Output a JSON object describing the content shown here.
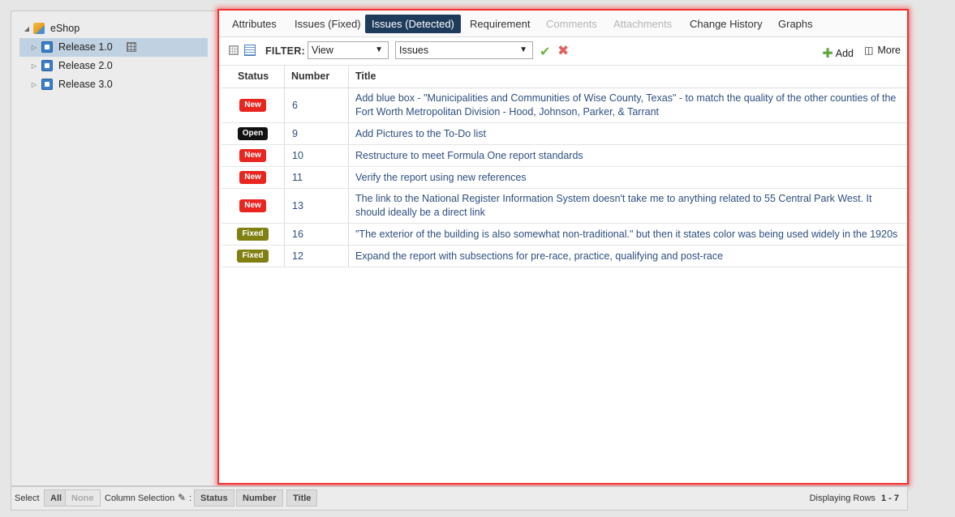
{
  "tree": {
    "root": "eShop",
    "items": [
      {
        "label": "Release 1.0",
        "selected": true
      },
      {
        "label": "Release 2.0",
        "selected": false
      },
      {
        "label": "Release 3.0",
        "selected": false
      }
    ]
  },
  "tabs": [
    {
      "label": "Attributes",
      "state": "normal"
    },
    {
      "label": "Issues (Fixed)",
      "state": "normal"
    },
    {
      "label": "Issues (Detected)",
      "state": "active"
    },
    {
      "label": "Requirement",
      "state": "normal"
    },
    {
      "label": "Comments",
      "state": "disabled"
    },
    {
      "label": "Attachments",
      "state": "disabled"
    },
    {
      "label": "Change History",
      "state": "normal"
    },
    {
      "label": "Graphs",
      "state": "normal"
    }
  ],
  "toolbar": {
    "filter_label": "FILTER:",
    "view_select": "View",
    "type_select": "Issues",
    "add_label": "Add",
    "more_label": "More"
  },
  "table": {
    "headers": {
      "status": "Status",
      "number": "Number",
      "title": "Title"
    },
    "rows": [
      {
        "status": "New",
        "number": "6",
        "title": "Add blue box - \"Municipalities and Communities of Wise County, Texas\" - to match the quality of the other counties of the Fort Worth Metropolitan Division - Hood, Johnson, Parker, & Tarrant"
      },
      {
        "status": "Open",
        "number": "9",
        "title": "Add Pictures to the To-Do list"
      },
      {
        "status": "New",
        "number": "10",
        "title": "Restructure to meet Formula One report standards"
      },
      {
        "status": "New",
        "number": "11",
        "title": "Verify the report using new references"
      },
      {
        "status": "New",
        "number": "13",
        "title": "The link to the National Register Information System doesn't take me to anything related to 55 Central Park West. It should ideally be a direct link"
      },
      {
        "status": "Fixed",
        "number": "16",
        "title": "\"The exterior of the building is also somewhat non-traditional.\" but then it states color was being used widely in the 1920s"
      },
      {
        "status": "Fixed",
        "number": "12",
        "title": "Expand the report with subsections for pre-race, practice, qualifying and post-race"
      }
    ]
  },
  "status_colors": {
    "New": "#e8251f",
    "Open": "#111111",
    "Fixed": "#7f7f12"
  },
  "bottom": {
    "select_label": "Select",
    "all_label": "All",
    "none_label": "None",
    "column_selection_label": "Column Selection",
    "columns": [
      "Status",
      "Number",
      "Title"
    ],
    "rows_label": "Displaying Rows",
    "rows_range": "1 - 7"
  }
}
